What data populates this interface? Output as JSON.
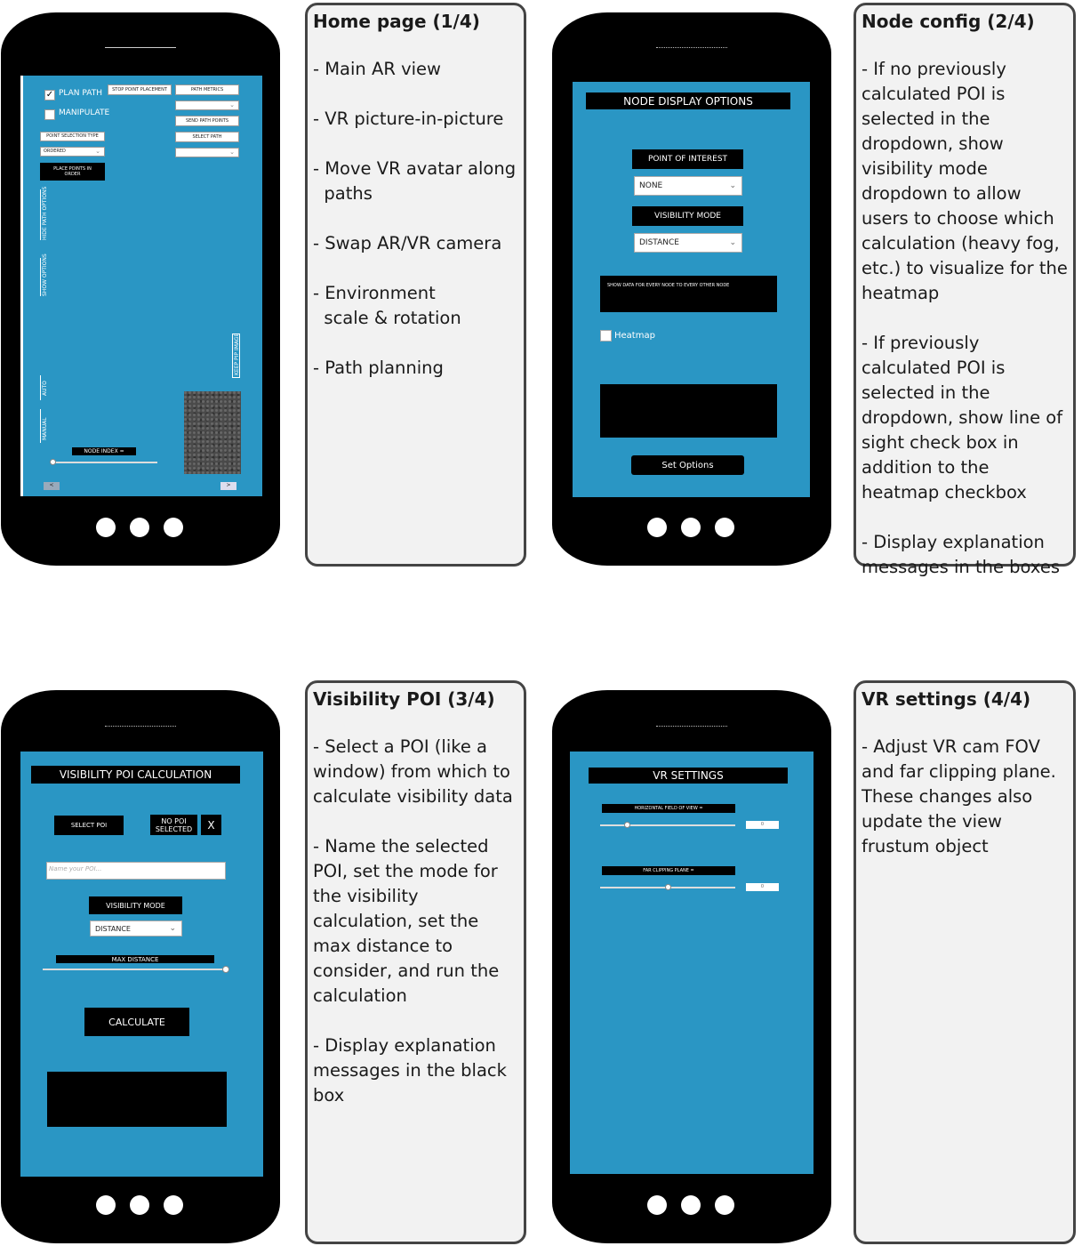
{
  "panels": [
    {
      "title": "Home page (1/4)",
      "items": [
        "- Main AR view",
        "- VR picture-in-picture",
        "- Move VR avatar along\n  paths",
        "- Swap AR/VR camera",
        "- Environment\n  scale & rotation",
        "- Path planning"
      ]
    },
    {
      "title": "Node config (2/4)",
      "items": [
        "- If no previously calculated POI is selected in the dropdown, show visibility mode dropdown to allow users to choose which calculation (heavy fog, etc.) to visualize for the heatmap",
        "- If previously calculated POI is selected in the dropdown, show line of sight check box in addition to the heatmap checkbox",
        "- Display explanation messages in the boxes"
      ]
    },
    {
      "title": "Visibility POI (3/4)",
      "items": [
        "- Select a POI (like a window) from which to calculate visibility data",
        "- Name the selected POI, set the mode for the visibility calculation, set the max distance to consider, and run the calculation",
        "- Display explanation messages in the black box"
      ]
    },
    {
      "title": "VR settings (4/4)",
      "items": [
        "- Adjust VR cam FOV and far clipping plane. These changes also update the view frustum object"
      ]
    }
  ],
  "home_screen": {
    "plan_path": "PLAN PATH",
    "manipulate": "MANIPULATE",
    "stop_point_placement": "STOP POINT PLACEMENT",
    "path_metrics": "PATH METRICS",
    "send_path_points": "SEND PATH POINTS",
    "point_selection_type": "POINT SELECTION TYPE",
    "select_path": "SELECT PATH",
    "ordered": "ORDERED",
    "place_points": "PLACE POINTS IN ORDER",
    "hide_path_options": "HIDE PATH OPTIONS",
    "show_options": "SHOW OPTIONS",
    "auto": "AUTO",
    "manual": "MANUAL",
    "keep_pip": "KEEP PIP IMAGE",
    "node_index": "NODE INDEX =",
    "prev": "<",
    "next": ">"
  },
  "node_screen": {
    "header": "NODE DISPLAY OPTIONS",
    "point_of_interest": "POINT OF INTEREST",
    "poi_value": "NONE",
    "visibility_mode": "VISIBILITY MODE",
    "mode_value": "DISTANCE",
    "message": "SHOW DATA FOR EVERY NODE TO EVERY OTHER NODE",
    "heatmap": "Heatmap",
    "set_options": "Set Options"
  },
  "poi_screen": {
    "header": "VISIBILITY POI CALCULATION",
    "select_poi": "SELECT POI",
    "no_poi": "NO POI SELECTED",
    "close": "X",
    "name_placeholder": "Name your POI...",
    "visibility_mode": "VISIBILITY MODE",
    "mode_value": "DISTANCE",
    "max_distance": "MAX DISTANCE",
    "max_distance_level": 1.0,
    "calculate": "CALCULATE"
  },
  "vr_screen": {
    "header": "VR SETTINGS",
    "fov_label": "HORIZONTAL FIELD OF VIEW =",
    "fov_value": "0",
    "fov_level": 0.2,
    "far_label": "FAR CLIPPING PLANE =",
    "far_value": "0",
    "far_level": 0.5
  }
}
